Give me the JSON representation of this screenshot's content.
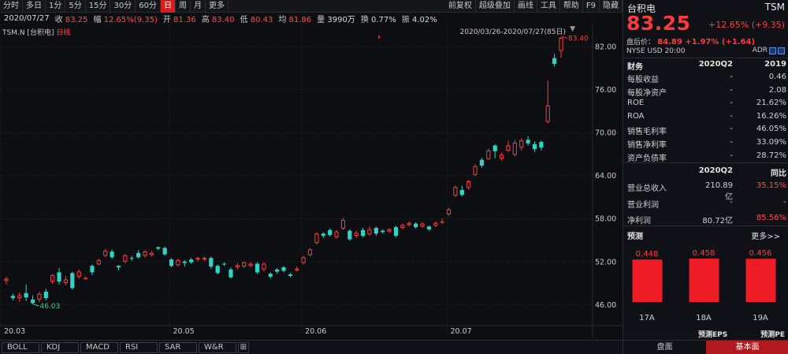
{
  "toolbar": {
    "left": [
      "分时",
      "多日",
      "1分",
      "5分",
      "15分",
      "30分",
      "60分",
      "日",
      "周",
      "月",
      "更多"
    ],
    "active_index": 7,
    "right": [
      "前复权",
      "超级叠加",
      "画线",
      "工具",
      "帮助",
      "F9",
      "隐藏"
    ]
  },
  "quote": {
    "date": "2020/07/27",
    "close_label": "收",
    "close": "83.25",
    "change_label": "幅",
    "change": "12.65%(9.35)",
    "open_label": "开",
    "open": "81.36",
    "high_label": "高",
    "high": "83.40",
    "low_label": "低",
    "low": "80.43",
    "avg_label": "均",
    "avg": "81.86",
    "volume_label": "量",
    "volume": "3990万",
    "turnover_label": "换",
    "turnover": "0.77%",
    "amplitude_label": "振",
    "amplitude": "4.02%"
  },
  "chart": {
    "symbol": "TSM.N [台积电]",
    "period": "日线",
    "range": "2020/03/26-2020/07/27(85日)",
    "high_marker": "83.40",
    "low_marker": "46.03",
    "colors": {
      "up": "#ff3b3b",
      "down": "#2fd3c8",
      "grid": "#252831",
      "axis_text": "#c8c8c8"
    }
  },
  "chart_data": {
    "type": "candlestick",
    "y_ticks": [
      "82.00",
      "76.00",
      "70.00",
      "64.00",
      "58.00",
      "52.00",
      "46.00"
    ],
    "ylim": [
      43.5,
      85.1
    ],
    "x_labels": [
      {
        "label": "20.03",
        "index": 0
      },
      {
        "label": "20.05",
        "index": 25
      },
      {
        "label": "20.06",
        "index": 45
      },
      {
        "label": "20.07",
        "index": 67
      }
    ],
    "candles": [
      [
        49.3,
        49.6,
        48.8,
        49.9
      ],
      [
        47.2,
        46.9,
        46.6,
        47.5
      ],
      [
        46.9,
        47.3,
        46.4,
        47.7
      ],
      [
        47.6,
        47.0,
        46.5,
        48.8
      ],
      [
        46.7,
        46.2,
        46.03,
        47.3
      ],
      [
        46.7,
        47.5,
        46.3,
        47.8
      ],
      [
        47.8,
        46.9,
        46.6,
        48.2
      ],
      [
        49.2,
        50.1,
        48.9,
        50.3
      ],
      [
        50.5,
        49.2,
        48.8,
        51.1
      ],
      [
        49.0,
        49.5,
        48.7,
        50.0
      ],
      [
        50.4,
        48.3,
        48.1,
        50.6
      ],
      [
        49.9,
        50.6,
        49.6,
        50.9
      ],
      [
        49.7,
        49.7,
        49.5,
        49.9
      ],
      [
        51.4,
        50.5,
        50.1,
        51.6
      ],
      [
        51.6,
        52.2,
        51.5,
        52.4
      ],
      [
        52.8,
        53.5,
        52.6,
        53.8
      ],
      [
        53.4,
        52.6,
        52.4,
        53.7
      ],
      [
        51.4,
        51.2,
        50.8,
        51.5
      ],
      [
        52.0,
        52.9,
        51.8,
        53.0
      ],
      [
        52.5,
        52.4,
        52.1,
        52.8
      ],
      [
        53.2,
        52.6,
        52.4,
        53.6
      ],
      [
        52.8,
        53.4,
        52.6,
        53.6
      ],
      [
        52.9,
        53.2,
        52.7,
        53.5
      ],
      [
        54.0,
        53.8,
        53.6,
        54.1
      ],
      [
        53.9,
        53.0,
        52.8,
        54.1
      ],
      [
        52.3,
        51.4,
        51.2,
        52.5
      ],
      [
        51.5,
        52.2,
        51.3,
        52.4
      ],
      [
        52.0,
        51.8,
        51.3,
        52.2
      ],
      [
        52.3,
        51.9,
        51.7,
        52.5
      ],
      [
        52.3,
        52.5,
        52.0,
        52.7
      ],
      [
        52.3,
        52.5,
        52.1,
        52.7
      ],
      [
        52.5,
        51.3,
        51.0,
        52.7
      ],
      [
        51.4,
        50.4,
        50.2,
        51.6
      ],
      [
        51.7,
        51.6,
        51.4,
        51.9
      ],
      [
        50.9,
        49.8,
        49.6,
        51.2
      ],
      [
        51.2,
        51.5,
        50.9,
        51.8
      ],
      [
        51.3,
        51.9,
        51.1,
        52.0
      ],
      [
        51.4,
        51.7,
        51.2,
        51.9
      ],
      [
        51.7,
        50.5,
        50.3,
        51.9
      ],
      [
        50.9,
        51.7,
        50.6,
        51.9
      ],
      [
        50.3,
        49.9,
        49.6,
        50.5
      ],
      [
        50.9,
        50.6,
        50.3,
        51.1
      ],
      [
        51.2,
        50.7,
        50.5,
        51.4
      ],
      [
        50.2,
        50.0,
        49.8,
        50.4
      ],
      [
        50.8,
        51.0,
        50.6,
        51.3
      ],
      [
        51.8,
        52.6,
        51.6,
        52.8
      ],
      [
        52.9,
        53.7,
        52.7,
        53.9
      ],
      [
        54.6,
        55.9,
        54.4,
        56.1
      ],
      [
        55.9,
        55.6,
        55.3,
        56.1
      ],
      [
        56.4,
        55.7,
        55.5,
        56.6
      ],
      [
        55.4,
        56.2,
        55.2,
        56.4
      ],
      [
        56.6,
        57.8,
        56.4,
        58.1
      ],
      [
        56.3,
        55.1,
        54.9,
        56.5
      ],
      [
        55.6,
        56.0,
        55.3,
        56.3
      ],
      [
        56.4,
        55.6,
        55.4,
        56.7
      ],
      [
        55.8,
        56.5,
        55.6,
        56.9
      ],
      [
        56.7,
        55.9,
        55.6,
        56.9
      ],
      [
        56.3,
        56.1,
        55.9,
        56.5
      ],
      [
        56.2,
        56.5,
        56.0,
        56.7
      ],
      [
        56.8,
        55.6,
        55.4,
        57.0
      ],
      [
        56.7,
        57.1,
        56.5,
        57.3
      ],
      [
        57.1,
        57.4,
        56.9,
        57.6
      ],
      [
        57.3,
        56.8,
        56.6,
        57.5
      ],
      [
        56.9,
        57.3,
        56.7,
        57.5
      ],
      [
        56.9,
        56.5,
        56.3,
        57.0
      ],
      [
        57.0,
        57.4,
        56.8,
        57.6
      ],
      [
        57.5,
        57.6,
        57.2,
        58.0
      ],
      [
        58.6,
        59.3,
        58.4,
        59.5
      ],
      [
        61.2,
        62.4,
        61.0,
        62.6
      ],
      [
        62.0,
        61.3,
        61.1,
        62.6
      ],
      [
        62.3,
        63.2,
        62.0,
        63.4
      ],
      [
        64.1,
        65.3,
        63.9,
        65.6
      ],
      [
        66.2,
        65.4,
        65.1,
        66.5
      ],
      [
        66.3,
        67.5,
        66.2,
        67.8
      ],
      [
        68.2,
        67.4,
        66.4,
        68.4
      ],
      [
        66.4,
        66.9,
        66.1,
        67.2
      ],
      [
        67.5,
        68.2,
        67.3,
        68.9
      ],
      [
        66.9,
        68.6,
        66.7,
        69.0
      ],
      [
        67.9,
        68.9,
        67.5,
        69.2
      ],
      [
        69.0,
        68.5,
        68.2,
        69.5
      ],
      [
        68.4,
        67.7,
        67.3,
        68.8
      ],
      [
        68.7,
        67.9,
        67.5,
        68.9
      ],
      [
        71.5,
        73.8,
        71.3,
        77.3
      ],
      [
        80.4,
        79.6,
        79.2,
        81.0
      ],
      [
        81.4,
        83.25,
        80.43,
        83.4
      ]
    ]
  },
  "indicators": [
    "BOLL",
    "KDJ",
    "MACD",
    "RSI",
    "SAR",
    "W&R",
    "⊞"
  ],
  "panel": {
    "name": "台积电",
    "code": "TSM",
    "price": "83.25",
    "change": "+12.65% (+9.35)",
    "after_hours_label": "盘后价：",
    "after_hours": "84.89 +1.97% (+1.64)",
    "info": "NYSE  USD  20:00",
    "adr": "ADR",
    "fin_header": {
      "k": "财务",
      "m": "2020Q2",
      "r": "2019"
    },
    "fin_rows": [
      {
        "k": "每股收益",
        "m": "-",
        "r": "0.46"
      },
      {
        "k": "每股净资产",
        "m": "-",
        "r": "2.08"
      },
      {
        "k": "ROE",
        "m": "-",
        "r": "21.62%"
      },
      {
        "k": "ROA",
        "m": "-",
        "r": "16.26%"
      },
      {
        "k": "销售毛利率",
        "m": "-",
        "r": "46.05%"
      },
      {
        "k": "销售净利率",
        "m": "-",
        "r": "33.09%"
      },
      {
        "k": "资产负债率",
        "m": "-",
        "r": "28.72%"
      }
    ],
    "inc_header": {
      "k": "",
      "m": "2020Q2",
      "r": "同比"
    },
    "inc_rows": [
      {
        "k": "营业总收入",
        "m": "210.89亿",
        "r": "35.15%"
      },
      {
        "k": "营业利润",
        "m": "-",
        "r": "-"
      },
      {
        "k": "净利润",
        "m": "80.72亿",
        "r": "85.56%"
      }
    ],
    "forecast_title": "预测",
    "forecast_more": "更多>>",
    "forecast": [
      {
        "label": "17A",
        "value": 0.448,
        "text": "0.448"
      },
      {
        "label": "18A",
        "value": 0.458,
        "text": "0.458"
      },
      {
        "label": "19A",
        "value": 0.456,
        "text": "0.456"
      }
    ],
    "forecast_color": "#ee1c25",
    "forecast_foot1": "预测EPS",
    "forecast_foot2": "预测PE",
    "tabs": [
      "盘面",
      "基本面"
    ],
    "active_tab": 1
  }
}
